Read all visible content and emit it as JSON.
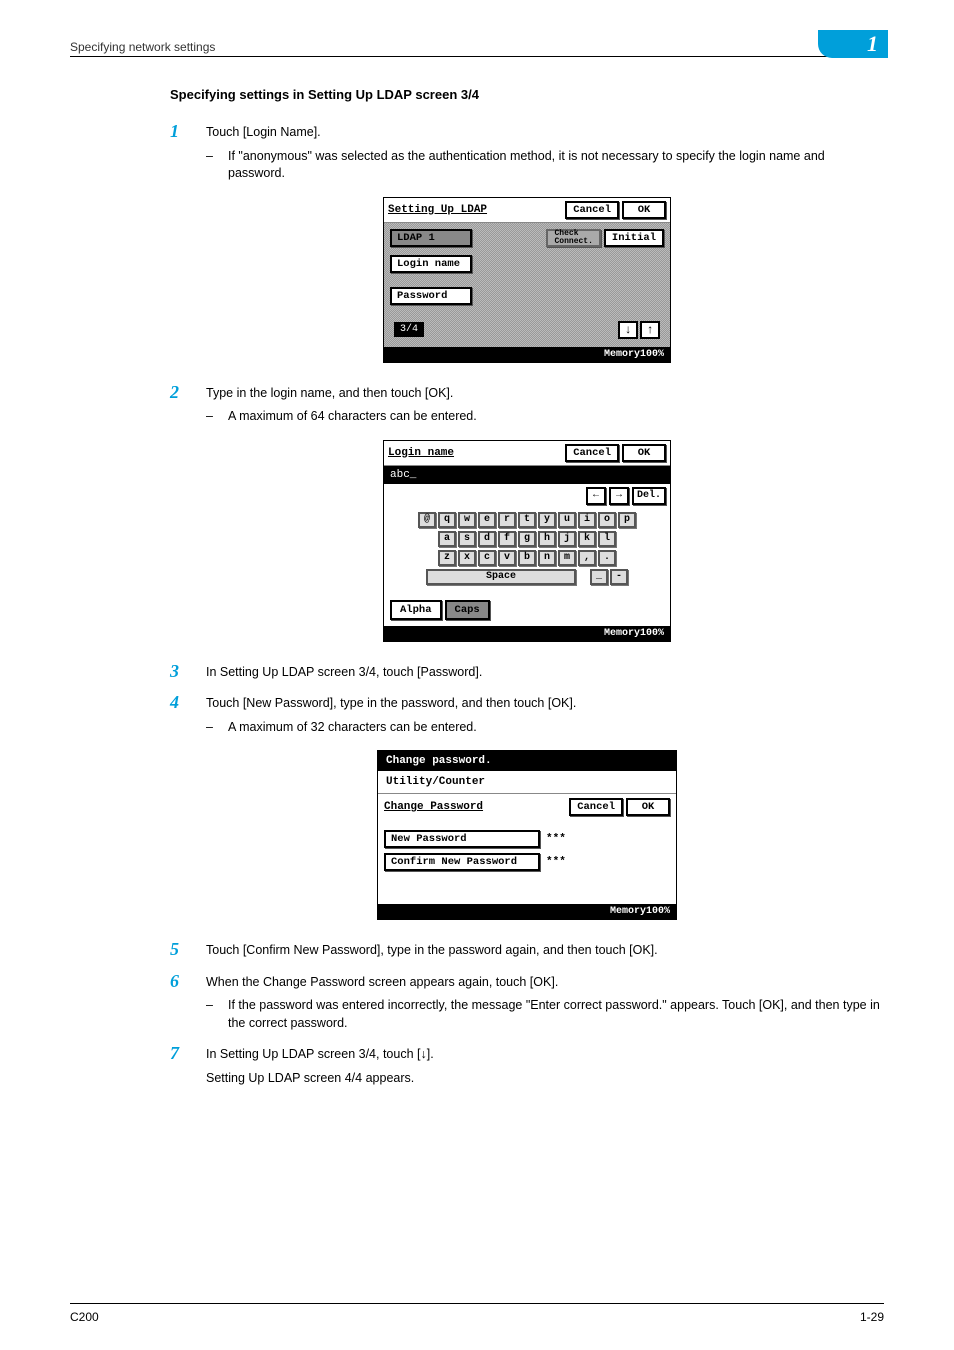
{
  "header": {
    "breadcrumb": "Specifying network settings",
    "chapter": "1"
  },
  "section_title": "Specifying settings in Setting Up LDAP screen 3/4",
  "steps": {
    "s1": {
      "num": "1",
      "text": "Touch [Login Name].",
      "sub1": "If \"anonymous\" was selected as the authentication method, it is not necessary to specify the login name and password."
    },
    "s2": {
      "num": "2",
      "text": "Type in the login name, and then touch [OK].",
      "sub1": "A maximum of 64 characters can be entered."
    },
    "s3": {
      "num": "3",
      "text": "In Setting Up LDAP screen 3/4, touch [Password]."
    },
    "s4": {
      "num": "4",
      "text": "Touch [New Password], type in the password, and then touch [OK].",
      "sub1": "A maximum of 32 characters can be entered."
    },
    "s5": {
      "num": "5",
      "text": "Touch [Confirm New Password], type in the password again, and then touch [OK]."
    },
    "s6": {
      "num": "6",
      "text": "When the Change Password screen appears again, touch [OK].",
      "sub1": "If the password was entered incorrectly, the message \"Enter correct password.\" appears. Touch [OK], and then type in the correct password."
    },
    "s7": {
      "num": "7",
      "text": "In Setting Up LDAP screen 3/4, touch [↓].",
      "after": "Setting Up LDAP screen 4/4 appears."
    }
  },
  "shot1": {
    "title": "Setting Up LDAP",
    "cancel": "Cancel",
    "ok": "OK",
    "ldap_label": "LDAP 1",
    "check": "Check\nConnect.",
    "initial": "Initial",
    "login_btn": "Login name",
    "password_btn": "Password",
    "pager": "3/4",
    "down": "↓",
    "up": "↑",
    "memory": "Memory100%"
  },
  "shot2": {
    "title": "Login name",
    "cancel": "Cancel",
    "ok": "OK",
    "input_value": "abc_",
    "left": "←",
    "right": "→",
    "del": "Del.",
    "rows": {
      "r1": [
        "@",
        "q",
        "w",
        "e",
        "r",
        "t",
        "y",
        "u",
        "i",
        "o",
        "p"
      ],
      "r2": [
        "a",
        "s",
        "d",
        "f",
        "g",
        "h",
        "j",
        "k",
        "l"
      ],
      "r3": [
        "z",
        "x",
        "c",
        "v",
        "b",
        "n",
        "m",
        ",",
        "."
      ]
    },
    "space": "Space",
    "underscore": "_",
    "dash": "-",
    "alpha": "Alpha",
    "caps": "Caps",
    "memory": "Memory100%"
  },
  "shot3": {
    "top": "Change password.",
    "util": "Utility/Counter",
    "head": "Change Password",
    "cancel": "Cancel",
    "ok": "OK",
    "newpw": "New Password",
    "newpw_val": "***",
    "confirm": "Confirm New Password",
    "confirm_val": "***",
    "memory": "Memory100%"
  },
  "footer": {
    "left": "C200",
    "right": "1-29"
  }
}
